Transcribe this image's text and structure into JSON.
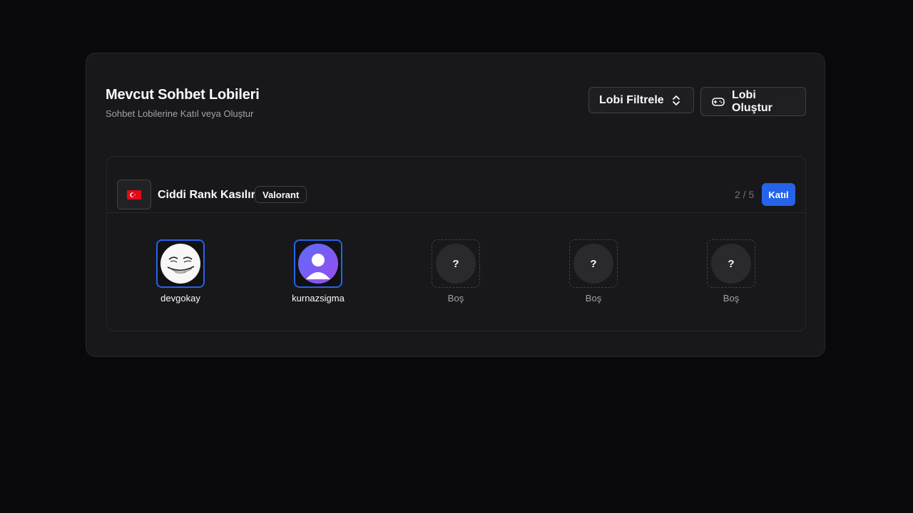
{
  "header": {
    "title": "Mevcut Sohbet Lobileri",
    "subtitle": "Sohbet Lobilerine Katıl veya Oluştur",
    "filter_label": "Lobi Filtrele",
    "create_label": "Lobi Oluştur"
  },
  "lobby": {
    "flag_icon": "turkey-flag-icon",
    "name": "Ciddi Rank Kasılır",
    "game": "Valorant",
    "count": "2 / 5",
    "join_label": "Katıl",
    "slots": [
      {
        "label": "devgokay",
        "status": "filled",
        "avatar": "troll-face-avatar"
      },
      {
        "label": "kurnazsigma",
        "status": "filled",
        "avatar": "default-user-avatar"
      },
      {
        "label": "Boş",
        "status": "empty",
        "placeholder": "?"
      },
      {
        "label": "Boş",
        "status": "empty",
        "placeholder": "?"
      },
      {
        "label": "Boş",
        "status": "empty",
        "placeholder": "?"
      }
    ]
  },
  "colors": {
    "accent": "#2563eb",
    "background": "#09090b",
    "panel": "#18181b",
    "border": "#27272a"
  }
}
